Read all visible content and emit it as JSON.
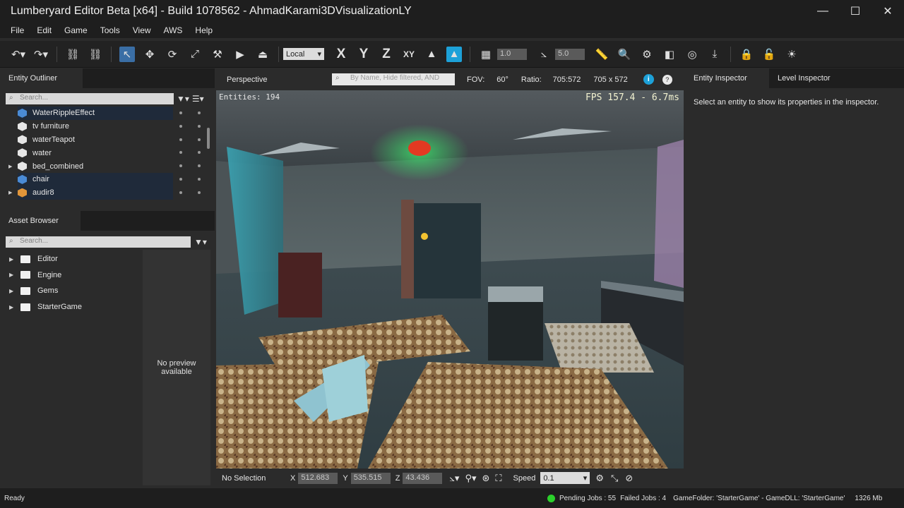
{
  "window": {
    "title": "Lumberyard Editor Beta [x64] - Build 1078562 - AhmadKarami3DVisualizationLY"
  },
  "menu": [
    "File",
    "Edit",
    "Game",
    "Tools",
    "View",
    "AWS",
    "Help"
  ],
  "toolbar": {
    "coord_mode": "Local",
    "axes": [
      "X",
      "Y",
      "Z",
      "XY"
    ],
    "snap_grid": "1.0",
    "snap_angle": "5.0"
  },
  "entity_outliner": {
    "tab": "Entity Outliner",
    "search_placeholder": "Search...",
    "items": [
      {
        "label": "WaterRippleEffect",
        "selected": true,
        "color": "#4a8bd6"
      },
      {
        "label": "tv furniture",
        "selected": false,
        "color": "#e6e6e6"
      },
      {
        "label": "waterTeapot",
        "selected": false,
        "color": "#e6e6e6"
      },
      {
        "label": "water",
        "selected": false,
        "color": "#e6e6e6"
      },
      {
        "label": "bed_combined",
        "selected": false,
        "color": "#e6e6e6"
      },
      {
        "label": "chair",
        "selected": true,
        "color": "#4a8bd6"
      },
      {
        "label": "audir8",
        "selected": true,
        "color": "#e0953a"
      }
    ]
  },
  "asset_browser": {
    "tab": "Asset Browser",
    "search_placeholder": "Search...",
    "folders": [
      "Editor",
      "Engine",
      "Gems",
      "StarterGame"
    ],
    "preview_text": "No preview available"
  },
  "viewport": {
    "camera": "Perspective",
    "search_placeholder": "By Name, Hide filtered, AND",
    "fov_label": "FOV:",
    "fov_value": "60°",
    "ratio_label": "Ratio:",
    "ratio_value": "705:572",
    "resolution": "705 x 572",
    "entities": "Entities: 194",
    "fps": "FPS 157.4 - 6.7ms",
    "selection": "No Selection",
    "x": "512.683",
    "y": "535.515",
    "z": "43.436",
    "speed_label": "Speed",
    "speed_value": "0.1"
  },
  "inspector": {
    "tabs": [
      "Entity Inspector",
      "Level Inspector"
    ],
    "message": "Select an entity to show its properties in the inspector."
  },
  "status": {
    "left": "Ready",
    "pending": "Pending Jobs : 55",
    "failed": "Failed Jobs : 4",
    "game": "GameFolder: 'StarterGame' - GameDLL: 'StarterGame'",
    "memory": "1326 Mb",
    "ok_color": "#2bd12b"
  }
}
